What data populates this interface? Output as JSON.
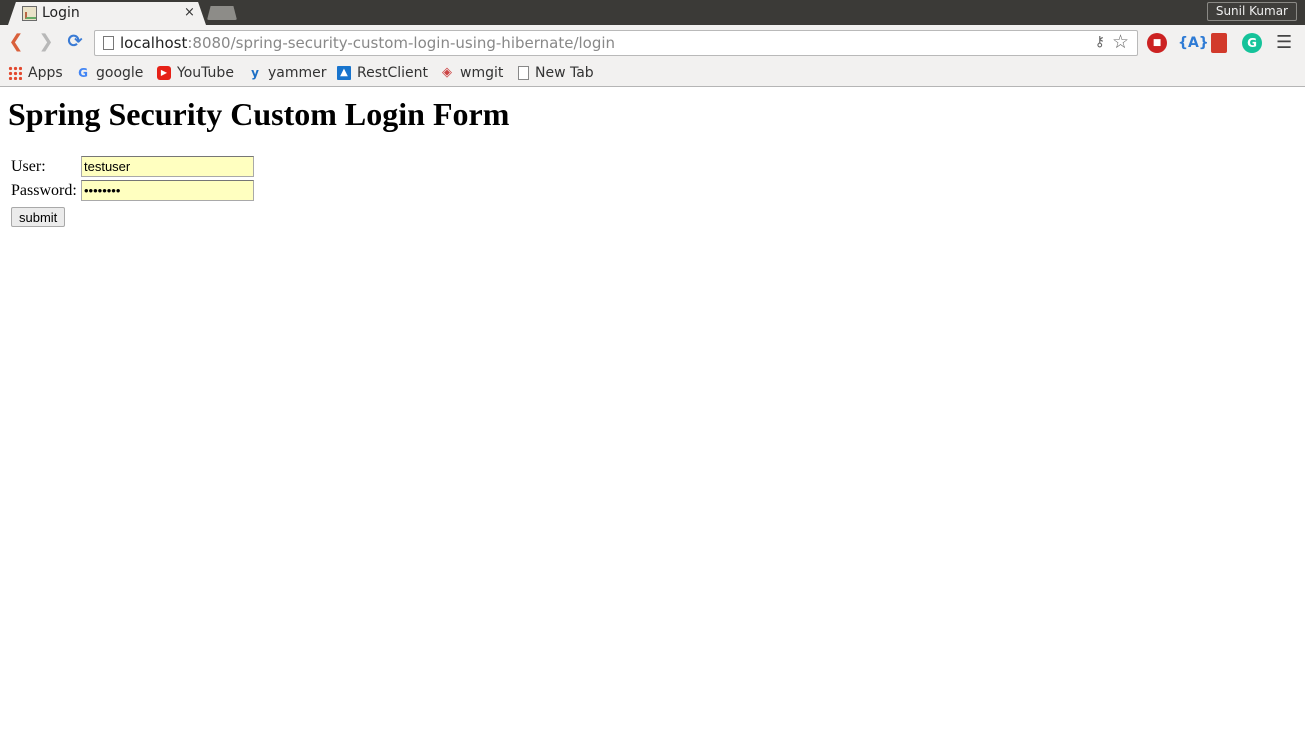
{
  "tab": {
    "title": "Login",
    "close": "×"
  },
  "profile": {
    "name": "Sunil Kumar"
  },
  "omnibox": {
    "host": "localhost",
    "rest": ":8080/spring-security-custom-login-using-hibernate/login"
  },
  "bookmarks": [
    {
      "label": "Apps"
    },
    {
      "label": "google"
    },
    {
      "label": "YouTube"
    },
    {
      "label": "yammer"
    },
    {
      "label": "RestClient"
    },
    {
      "label": "wmgit"
    },
    {
      "label": "New Tab"
    }
  ],
  "page": {
    "title": "Spring Security Custom Login Form",
    "user_label": "User:",
    "user_value": "testuser",
    "password_label": "Password:",
    "password_value": "testuser",
    "submit_label": "submit"
  }
}
